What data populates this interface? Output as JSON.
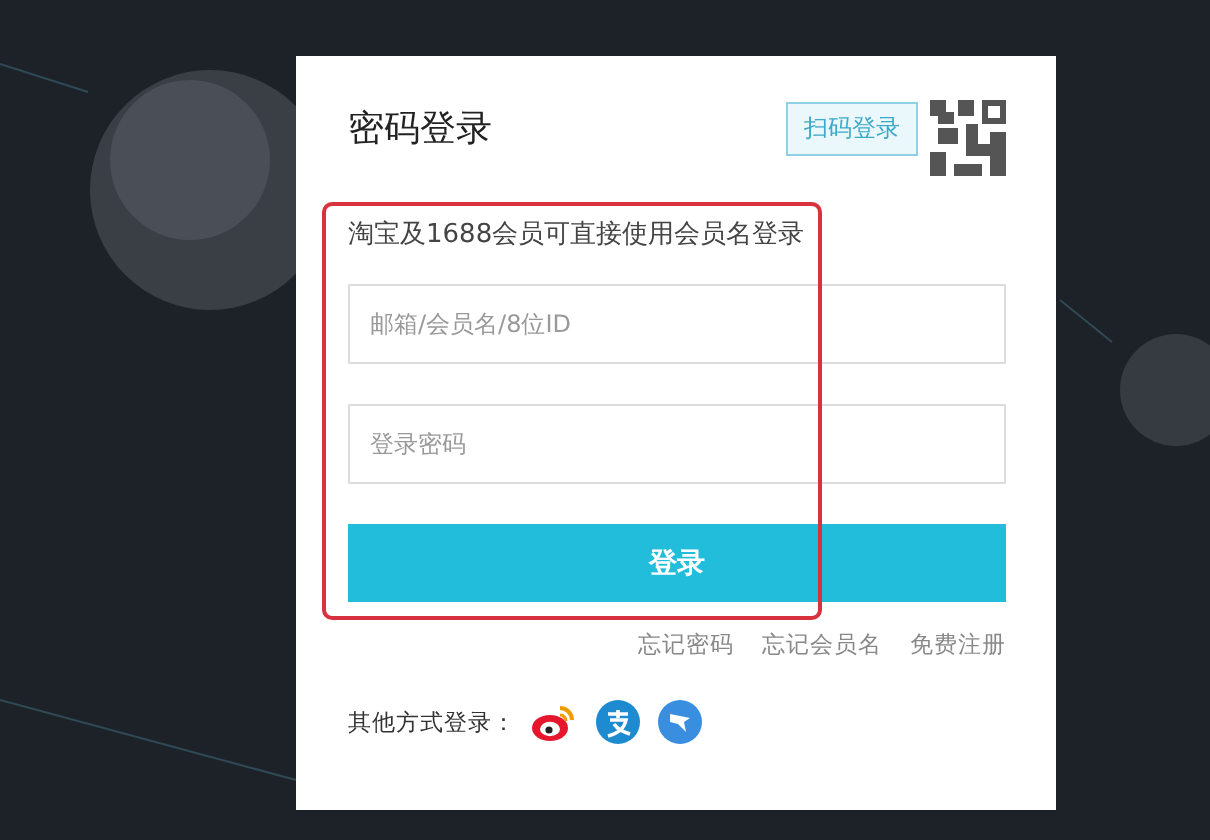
{
  "login_card": {
    "title": "密码登录",
    "qr_tip": "扫码登录",
    "subtitle": "淘宝及1688会员可直接使用会员名登录",
    "fields": [
      {
        "placeholder": "邮箱/会员名/8位ID"
      },
      {
        "placeholder": "登录密码"
      }
    ],
    "submit": "登录",
    "links": [
      "忘记密码",
      "忘记会员名",
      "免费注册"
    ],
    "other_label": "其他方式登录：",
    "other_methods": [
      {
        "kind": "weibo"
      },
      {
        "kind": "alipay"
      },
      {
        "kind": "bird"
      }
    ]
  }
}
